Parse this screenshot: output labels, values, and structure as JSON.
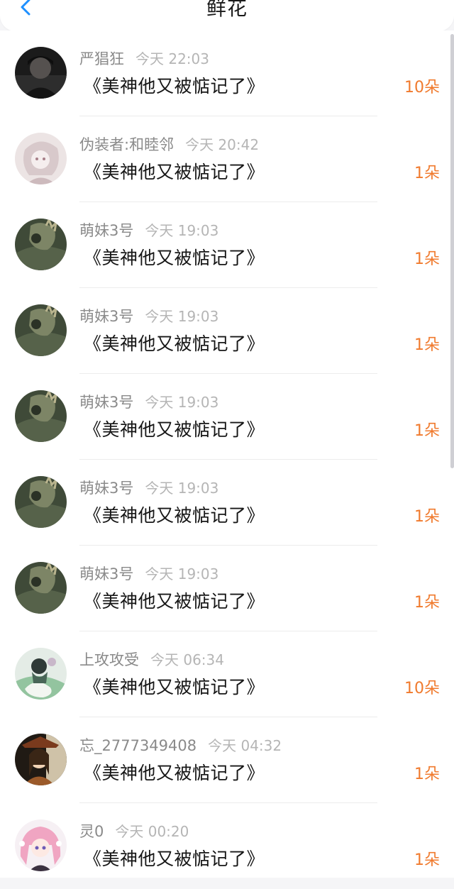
{
  "header": {
    "title": "鲜花",
    "back_icon": "chevron-left-icon",
    "accent_color": "#1e90ff"
  },
  "count_color": "#f07a2d",
  "items": [
    {
      "user": "严猖狂",
      "time": "今天 22:03",
      "book": "《美神他又被惦记了》",
      "count": "10朵",
      "avatar": "dark-portrait"
    },
    {
      "user": "伪装者:和睦邻",
      "time": "今天 20:42",
      "book": "《美神他又被惦记了》",
      "count": "1朵",
      "avatar": "pale-anime-portrait"
    },
    {
      "user": "萌妹3号",
      "time": "今天 19:03",
      "book": "《美神他又被惦记了》",
      "count": "1朵",
      "avatar": "green-dark-art"
    },
    {
      "user": "萌妹3号",
      "time": "今天 19:03",
      "book": "《美神他又被惦记了》",
      "count": "1朵",
      "avatar": "green-dark-art"
    },
    {
      "user": "萌妹3号",
      "time": "今天 19:03",
      "book": "《美神他又被惦记了》",
      "count": "1朵",
      "avatar": "green-dark-art"
    },
    {
      "user": "萌妹3号",
      "time": "今天 19:03",
      "book": "《美神他又被惦记了》",
      "count": "1朵",
      "avatar": "green-dark-art"
    },
    {
      "user": "萌妹3号",
      "time": "今天 19:03",
      "book": "《美神他又被惦记了》",
      "count": "1朵",
      "avatar": "green-dark-art"
    },
    {
      "user": "上攻攻受",
      "time": "今天 06:34",
      "book": "《美神他又被惦记了》",
      "count": "10朵",
      "avatar": "green-white-anime"
    },
    {
      "user": "忘_2777349408",
      "time": "今天 04:32",
      "book": "《美神他又被惦记了》",
      "count": "1朵",
      "avatar": "golden-anime-portrait"
    },
    {
      "user": "灵0",
      "time": "今天 00:20",
      "book": "《美神他又被惦记了》",
      "count": "1朵",
      "avatar": "pink-hair-anime"
    }
  ]
}
